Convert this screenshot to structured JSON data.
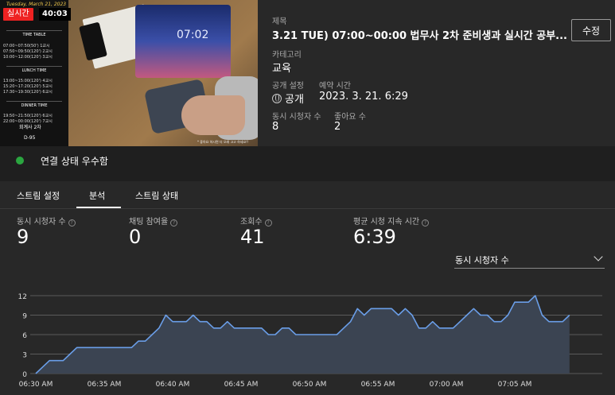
{
  "thumbnail": {
    "live_badge": "실시간",
    "live_duration": "40:03",
    "banner_date": "Tuesday, March 21, 2023",
    "monitor_clock": "07:02",
    "timetable_title": "TIME TABLE",
    "timetable_rows": [
      "07:00~07:50(50') 1교시",
      "07:50~09:50(120') 2교시",
      "10:00~12:00(120') 3교시"
    ],
    "lunch_title": "LUNCH TIME",
    "lunch_rows": [
      "13:00~15:00(120') 4교시",
      "15:20~17:20(120') 5교시",
      "17:30~19:30(120') 6교시"
    ],
    "dinner_title": "DINNER TIME",
    "dinner_rows": [
      "19:50~21:50(120') 6교시",
      "22:00~00:00(120') 7교시"
    ],
    "exam_name": "회계사 2차",
    "dday": "D-95",
    "note": "* 좋아요 하시면 더 오래 고고 하세요!!"
  },
  "info": {
    "title_label": "제목",
    "title_value": "3.21 TUE) 07:00~00:00 법무사 2차 준비생과 실시간 공부...",
    "category_label": "카테고리",
    "category_value": "교육",
    "privacy_label": "공개 설정",
    "privacy_value": "공개",
    "scheduled_label": "예약 시간",
    "scheduled_value": "2023. 3. 21. 6:29",
    "concurrent_label": "동시 시청자 수",
    "concurrent_value": "8",
    "likes_label": "좋아요 수",
    "likes_value": "2",
    "edit_button": "수정"
  },
  "connection": {
    "status_text": "연결 상태 우수함",
    "status_color": "#2ba640"
  },
  "tabs": [
    {
      "label": "스트림 설정",
      "active": false
    },
    {
      "label": "분석",
      "active": true
    },
    {
      "label": "스트림 상태",
      "active": false
    }
  ],
  "metrics": [
    {
      "label": "동시 시청자 수",
      "value": "9"
    },
    {
      "label": "채팅 참여율",
      "value": "0"
    },
    {
      "label": "조회수",
      "value": "41"
    },
    {
      "label": "평균 시청 지속 시간",
      "value": "6:39"
    }
  ],
  "dropdown": {
    "selected": "동시 시청자 수"
  },
  "chart_data": {
    "type": "area",
    "title": "",
    "xlabel": "",
    "ylabel": "",
    "ylim": [
      0,
      12
    ],
    "y_ticks": [
      0,
      3,
      6,
      9,
      12
    ],
    "x_tick_labels": [
      "06:30 AM",
      "06:35 AM",
      "06:40 AM",
      "06:45 AM",
      "06:50 AM",
      "06:55 AM",
      "07:00 AM",
      "07:05 AM"
    ],
    "x_minutes_per_point": 0.5,
    "series": [
      {
        "name": "",
        "color": "#6a9ee8",
        "values": [
          0,
          1,
          2,
          2,
          2,
          3,
          4,
          4,
          4,
          4,
          4,
          4,
          4,
          4,
          4,
          5,
          5,
          6,
          7,
          9,
          8,
          8,
          8,
          9,
          8,
          8,
          7,
          7,
          8,
          7,
          7,
          7,
          7,
          7,
          6,
          6,
          7,
          7,
          6,
          6,
          6,
          6,
          6,
          6,
          6,
          7,
          8,
          10,
          9,
          10,
          10,
          10,
          10,
          9,
          10,
          9,
          7,
          7,
          8,
          7,
          7,
          7,
          8,
          9,
          10,
          9,
          9,
          8,
          8,
          9,
          11,
          11,
          11,
          12,
          9,
          8,
          8,
          8,
          9
        ]
      }
    ],
    "grid": true,
    "gridline_color": "#5a5a5a",
    "fill_color": "#3b4452"
  }
}
